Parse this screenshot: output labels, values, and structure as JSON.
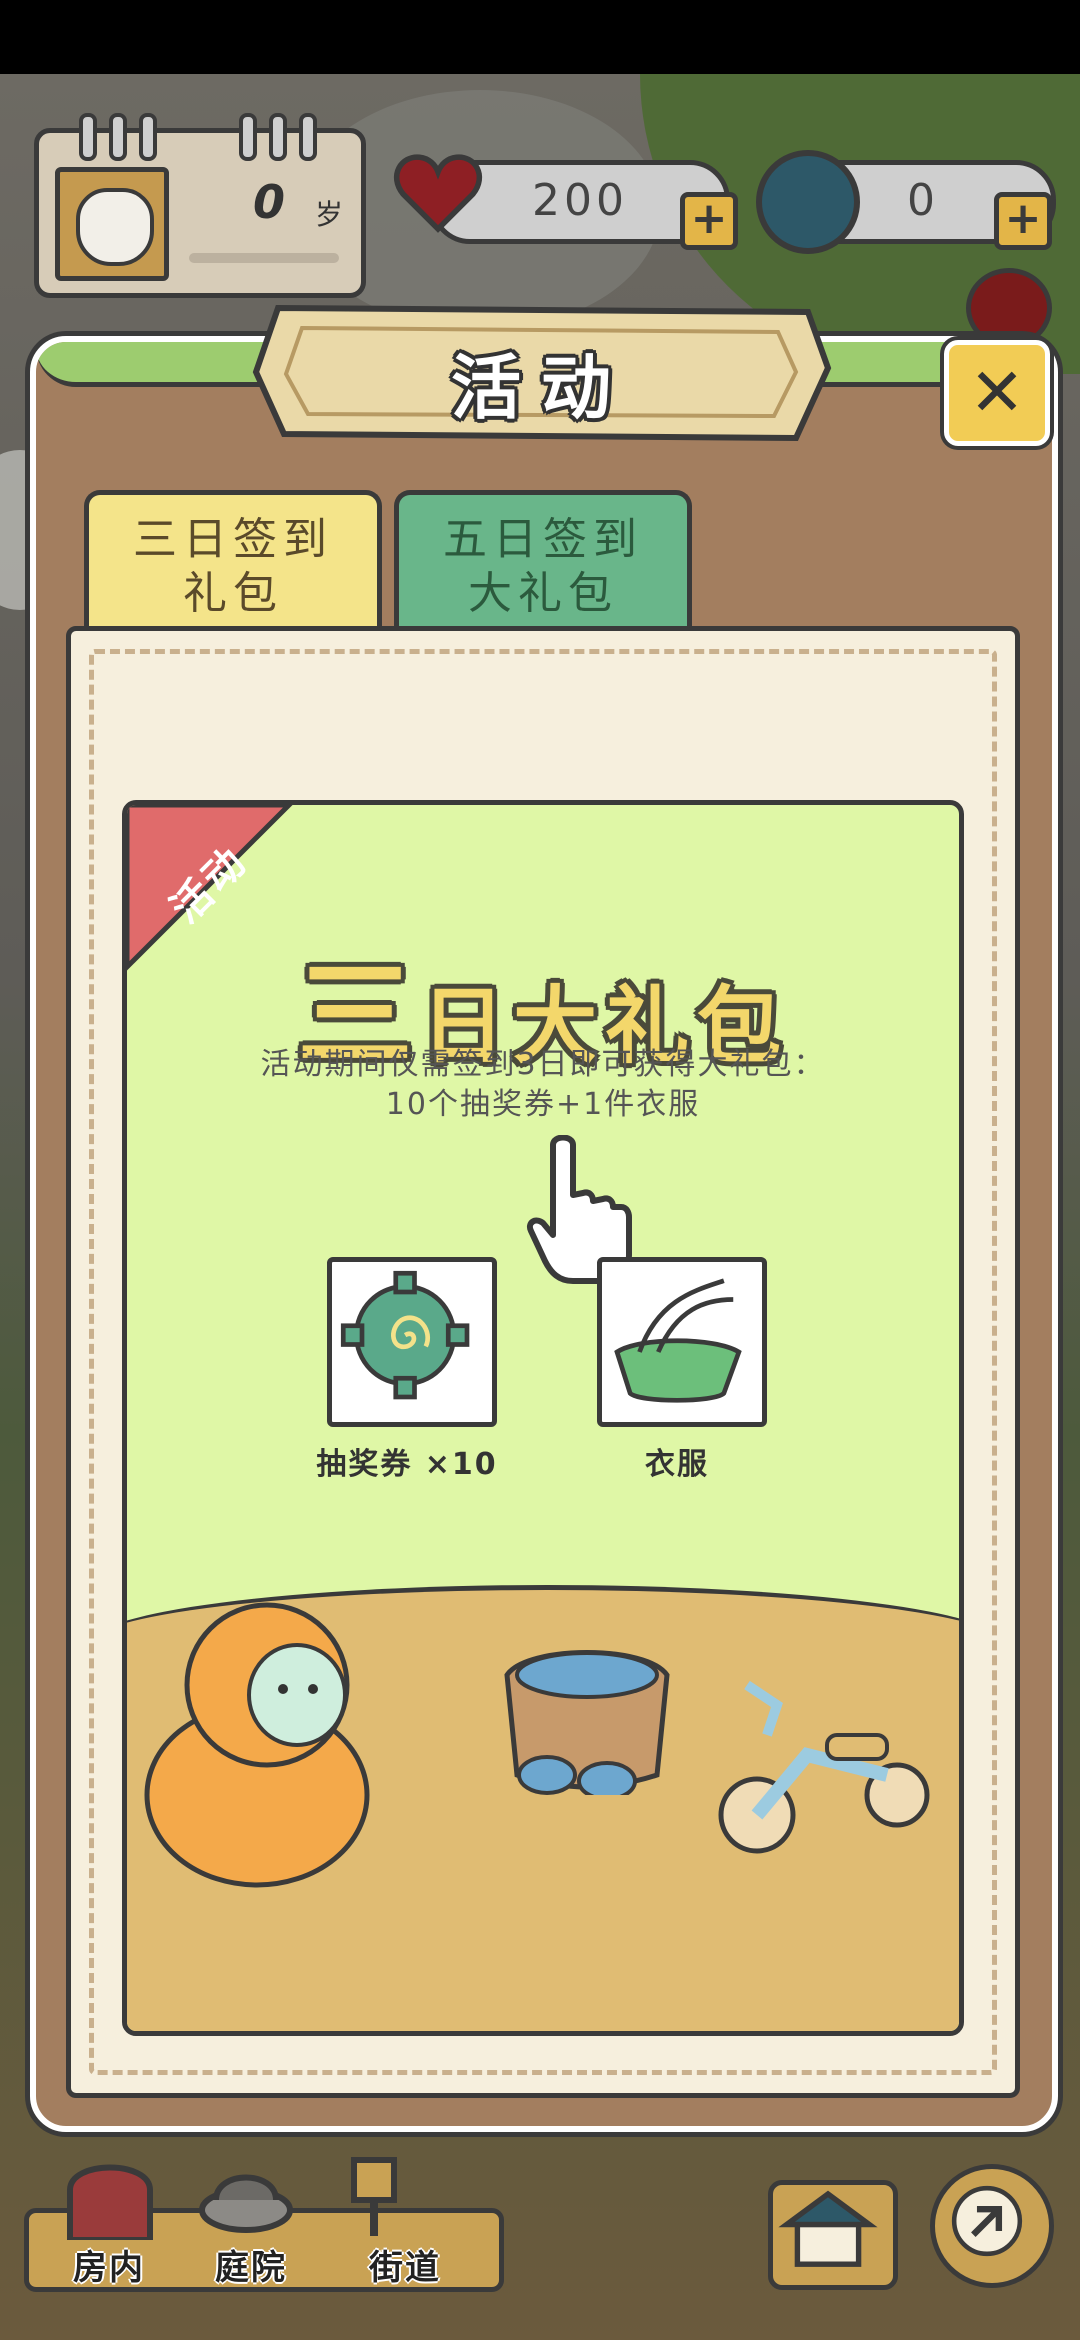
{
  "hud": {
    "age_value": "0",
    "age_unit": "岁",
    "hearts_value": "200",
    "coins_value": "0",
    "plus_label": "+"
  },
  "modal": {
    "title": "活动",
    "close_label": "✕",
    "tabs": [
      {
        "label_line1": "三日签到",
        "label_line2": "礼包",
        "selected": true
      },
      {
        "label_line1": "五日签到",
        "label_line2": "大礼包",
        "selected": false
      }
    ],
    "card": {
      "ribbon": "活动",
      "headline_big": "三",
      "headline_rest": "日大礼包",
      "description_line1": "活动期间仅需签到3日即可获得大礼包：",
      "description_line2": "10个抽奖券+1件衣服",
      "rewards": [
        {
          "label": "抽奖券 ×10",
          "icon": "lottery-ticket-icon"
        },
        {
          "label": "衣服",
          "icon": "clothes-icon"
        }
      ]
    }
  },
  "nav": {
    "items": [
      {
        "label": "房内",
        "icon": "room-door-icon"
      },
      {
        "label": "庭院",
        "icon": "yard-icon"
      },
      {
        "label": "街道",
        "icon": "street-sign-icon"
      }
    ],
    "home_icon": "house-icon",
    "back_icon": "arrow-icon"
  },
  "colors": {
    "tab_selected": "#f4e48a",
    "tab_unselected": "#69b68a",
    "card_bg": "#dff7a6",
    "ribbon": "#e06b6b",
    "headline": "#f3d76b",
    "close_button": "#f2cc55"
  }
}
